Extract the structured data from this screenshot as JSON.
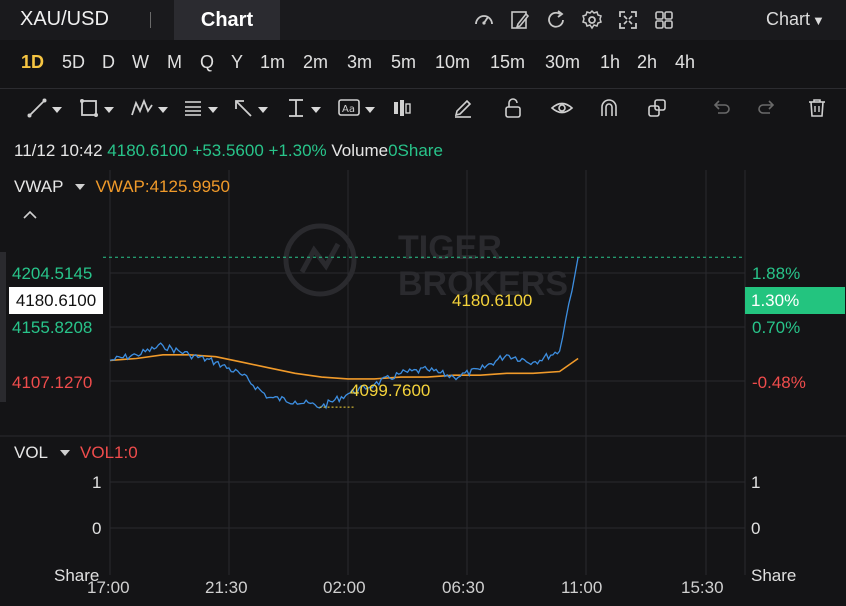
{
  "header": {
    "symbol": "XAU/USD",
    "active_tab": "Chart",
    "chart_menu_label": "Chart",
    "icons": [
      "gauge-icon",
      "edit-icon",
      "refresh-icon",
      "settings-icon",
      "fullscreen-icon",
      "grid-icon"
    ]
  },
  "periods": [
    {
      "label": "1D",
      "active": true
    },
    {
      "label": "5D"
    },
    {
      "label": "D"
    },
    {
      "label": "W"
    },
    {
      "label": "M"
    },
    {
      "label": "Q"
    },
    {
      "label": "Y"
    },
    {
      "label": "1m"
    },
    {
      "label": "2m"
    },
    {
      "label": "3m"
    },
    {
      "label": "5m"
    },
    {
      "label": "10m"
    },
    {
      "label": "15m"
    },
    {
      "label": "30m"
    },
    {
      "label": "1h"
    },
    {
      "label": "2h"
    },
    {
      "label": "4h"
    }
  ],
  "toolbar": {
    "tools": [
      "trend-line-icon",
      "rectangle-icon",
      "pattern-icon",
      "fibonacci-icon",
      "arrow-icon",
      "measure-icon",
      "text-icon",
      "candles-icon",
      "pencil-icon",
      "lock-icon",
      "eye-icon",
      "magnet-icon",
      "copy-icon",
      "undo-icon",
      "redo-icon",
      "trash-icon"
    ]
  },
  "quote": {
    "time": "11/12 10:42",
    "price": "4180.6100",
    "change": "+53.5600",
    "change_pct": "+1.30%",
    "volume_label": "Volume",
    "volume_value": "0Share"
  },
  "main_indicator": {
    "name": "VWAP",
    "value_label": "VWAP:4125.9950"
  },
  "price_axis": {
    "labels": [
      "4204.5145",
      "4155.8208",
      "4107.1270"
    ],
    "current": "4180.6100"
  },
  "pct_axis": {
    "labels": [
      "1.88%",
      "0.70%",
      "-0.48%"
    ],
    "current": "1.30%"
  },
  "annotations": {
    "current_price": "4180.6100",
    "low_price": "4099.7600"
  },
  "volume_panel": {
    "name": "VOL",
    "value_label": "VOL1:0",
    "left_values": [
      "1",
      "0",
      "Share"
    ],
    "right_values": [
      "1",
      "0",
      "Share"
    ]
  },
  "time_axis": [
    "17:00",
    "21:30",
    "02:00",
    "06:30",
    "11:00",
    "15:30"
  ],
  "colors": {
    "up": "#28c48a",
    "down": "#ef4c4c",
    "vwap": "#f09a2a",
    "price_line": "#3d8ee0",
    "annotation": "#f5d33b",
    "active_period": "#f6c542"
  },
  "chart_data": {
    "type": "line",
    "x": [
      "17:00",
      "18:00",
      "19:00",
      "20:00",
      "21:00",
      "22:00",
      "23:00",
      "00:00",
      "01:00",
      "02:00",
      "03:00",
      "04:00",
      "05:00",
      "06:00",
      "07:00",
      "08:00",
      "09:00",
      "10:00",
      "10:42"
    ],
    "series": [
      {
        "name": "price",
        "values": [
          4125,
          4128,
          4133,
          4128,
          4124,
          4117,
          4105,
          4103,
          4100,
          4107,
          4112,
          4118,
          4120,
          4116,
          4120,
          4128,
          4124,
          4130,
          4180.61
        ]
      },
      {
        "name": "VWAP",
        "values": [
          4125,
          4126,
          4128,
          4128,
          4127,
          4124,
          4121,
          4118,
          4116,
          4115,
          4115,
          4116,
          4116,
          4117,
          4117,
          4118,
          4118,
          4119,
          4125.995
        ]
      }
    ],
    "ylim": [
      4088,
      4226
    ],
    "x_range": [
      "17:00",
      "15:30"
    ]
  }
}
